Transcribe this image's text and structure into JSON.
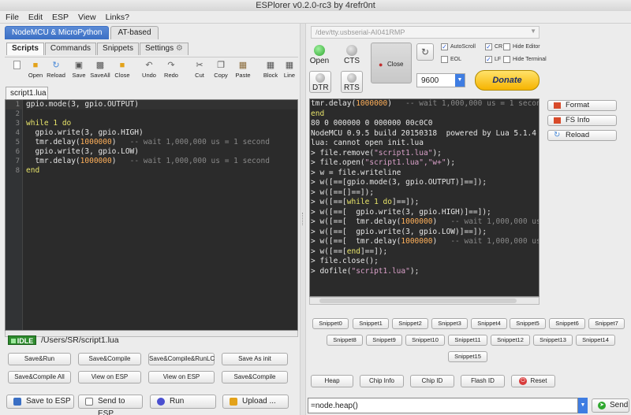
{
  "window": {
    "title": "ESPlorer v0.2.0-rc3 by 4refr0nt"
  },
  "menu": [
    "File",
    "Edit",
    "ESP",
    "View",
    "Links?"
  ],
  "left": {
    "top_tabs": [
      "NodeMCU & MicroPython",
      "AT-based"
    ],
    "sub_tabs": [
      "Scripts",
      "Commands",
      "Snippets",
      "Settings"
    ],
    "toolbar": [
      {
        "label": "Open",
        "icon": "folder-icon"
      },
      {
        "label": "Reload",
        "icon": "reload-icon"
      },
      {
        "label": "Save",
        "icon": "save-icon"
      },
      {
        "label": "SaveAll",
        "icon": "save-all-icon"
      },
      {
        "label": "Close",
        "icon": "close-file-icon"
      },
      {
        "label": "Undo",
        "icon": "undo-icon"
      },
      {
        "label": "Redo",
        "icon": "redo-icon"
      },
      {
        "label": "Cut",
        "icon": "cut-icon"
      },
      {
        "label": "Copy",
        "icon": "copy-icon"
      },
      {
        "label": "Paste",
        "icon": "paste-icon"
      },
      {
        "label": "Block",
        "icon": "block-icon"
      },
      {
        "label": "Line",
        "icon": "line-icon"
      }
    ],
    "file_tab": "script1.lua",
    "line_numbers": [
      "1",
      "2",
      "3",
      "4",
      "5",
      "6",
      "7",
      "8"
    ],
    "code": {
      "l1": "gpio.mode(3, gpio.OUTPUT)",
      "l3_kw": "while",
      "l3_num": "1",
      "l3_kw2": "do",
      "l4": "gpio.write(3, gpio.HIGH)",
      "l5_a": "tmr.delay(",
      "l5_num": "1000000",
      "l5_b": ")",
      "l5_cmt": "-- wait 1,000,000 us = 1 second",
      "l6": "gpio.write(3, gpio.LOW)",
      "l7_a": "tmr.delay(",
      "l7_num": "1000000",
      "l7_b": ")",
      "l7_cmt": "-- wait 1,000,000 us = 1 second",
      "l8_kw": "end"
    },
    "status": {
      "badge": "IDLE",
      "path": "/Users/SR/script1.lua"
    },
    "buttons_row1": [
      "Save&Run",
      "Save&Compile",
      "Save&Compile&RunLC",
      "Save As init"
    ],
    "buttons_row2": [
      "Save&Compile All",
      "View on ESP",
      "View on ESP",
      "Save&Compile"
    ],
    "big_buttons": [
      {
        "label": "Save to ESP",
        "icon": "save-to-esp-icon"
      },
      {
        "label": "Send to ESP",
        "icon": "send-to-esp-icon"
      },
      {
        "label": "Run",
        "icon": "run-icon"
      },
      {
        "label": "Upload ...",
        "icon": "upload-icon"
      }
    ]
  },
  "right": {
    "port": "/dev/tty.usbserial-AI041RMP",
    "open_label": "Open",
    "cts_label": "CTS",
    "close_label": "Close",
    "dtr_label": "DTR",
    "rts_label": "RTS",
    "checks": [
      {
        "label": "AutoScroll",
        "checked": true
      },
      {
        "label": "CR",
        "checked": true
      },
      {
        "label": "Hide Editor",
        "checked": false
      },
      {
        "label": "EOL",
        "checked": false
      },
      {
        "label": "LF",
        "checked": true
      },
      {
        "label": "Hide Terminal",
        "checked": false
      }
    ],
    "baud": "9600",
    "donate": "Donate",
    "terminal": [
      {
        "t": "tmr.delay(",
        "n": "1000000",
        "r": ")",
        "c": "   -- wait 1,000,000 us = 1 secon"
      },
      {
        "kw": "end"
      },
      {
        "raw": "80 0 000000 0 000000 00c0C0"
      },
      {
        "p": "NodeMCU 0.9.5 build 20150318  powered by Lua 5.1.4"
      },
      {
        "p": "lua: cannot open init.lua"
      },
      {
        "p": "> file.remove(",
        "s": "\"script1.lua\"",
        "e": ");"
      },
      {
        "p": "> file.open(",
        "s": "\"script1.lua\",\"w+\"",
        "e": ");"
      },
      {
        "p": "> w = file.writeline"
      },
      {
        "p": "> w([==[gpio.mode(3, gpio.OUTPUT)]==]);"
      },
      {
        "p": "> w([==[]==]);"
      },
      {
        "p": "> w([==[",
        "kw": "while",
        "m": " 1 ",
        "kw2": "do",
        "e": "]==]);"
      },
      {
        "p": "> w([==[  gpio.write(3, gpio.HIGH)]==]);"
      },
      {
        "p": "> w([==[  tmr.delay(",
        "n": "1000000",
        "r": ")",
        "c": "   -- wait 1,000,000 us"
      },
      {
        "p": "> w([==[  gpio.write(3, gpio.LOW)]==]);"
      },
      {
        "p": "> w([==[  tmr.delay(",
        "n": "1000000",
        "r": ")",
        "c": "   -- wait 1,000,000 us"
      },
      {
        "p": "> w([==[",
        "kw": "end",
        "e": "]==]);"
      },
      {
        "p": "> file.close();"
      },
      {
        "p": "> dofile(",
        "s": "\"script1.lua\"",
        "e": ");"
      }
    ],
    "side_buttons": [
      {
        "label": "Format",
        "icon": "format-icon"
      },
      {
        "label": "FS Info",
        "icon": "fs-info-icon"
      },
      {
        "label": "Reload",
        "icon": "reload-icon"
      }
    ],
    "snippets": [
      "Snippet0",
      "Snippet1",
      "Snippet2",
      "Snippet3",
      "Snippet4",
      "Snippet5",
      "Snippet6",
      "Snippet7",
      "Snippet8",
      "Snippet9",
      "Snippet10",
      "Snippet11",
      "Snippet12",
      "Snippet13",
      "Snippet14",
      "Snippet15"
    ],
    "commands": [
      "Heap",
      "Chip Info",
      "Chip ID",
      "Flash ID",
      "Reset"
    ],
    "command_input": "=node.heap()",
    "send": "Send"
  },
  "colors": {
    "editor_bg": "#2b2b2b",
    "keyword": "#e8e46a",
    "number": "#ffb05a",
    "idle_green": "#2e8b2e",
    "accent_blue": "#3f7de2"
  }
}
